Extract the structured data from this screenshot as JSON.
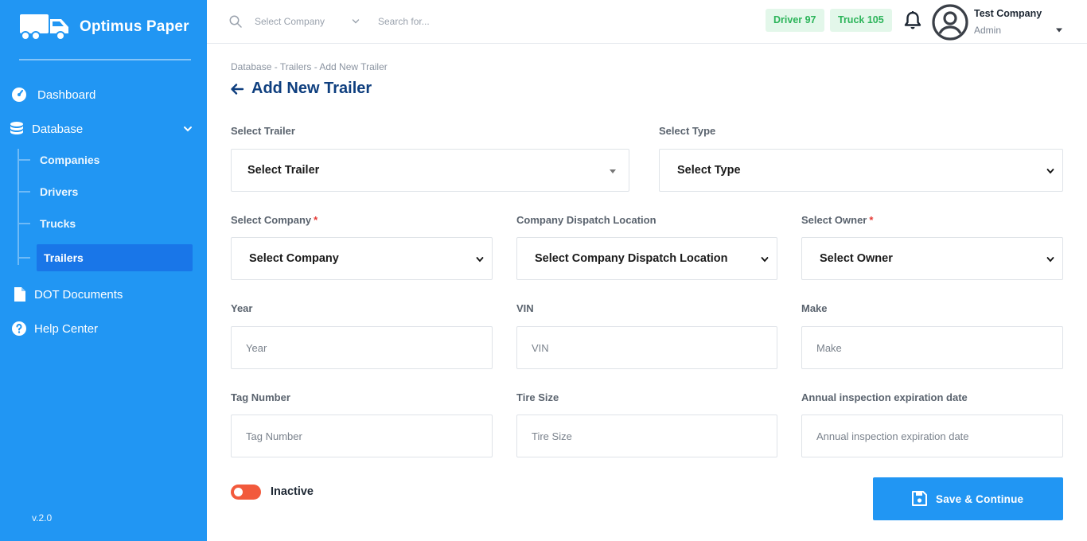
{
  "brand": {
    "name": "Optimus Paper",
    "version": "v.2.0"
  },
  "sidebar": {
    "items": [
      {
        "label": "Dashboard",
        "icon": "gauge-icon"
      },
      {
        "label": "Database",
        "icon": "database-icon"
      },
      {
        "label": "DOT Documents",
        "icon": "document-icon"
      },
      {
        "label": "Help Center",
        "icon": "help-icon"
      }
    ],
    "database_children": [
      {
        "label": "Companies"
      },
      {
        "label": "Drivers"
      },
      {
        "label": "Trucks"
      },
      {
        "label": "Trailers",
        "active": true
      }
    ]
  },
  "header": {
    "company_select": "Select Company",
    "search_placeholder": "Search for...",
    "badges": [
      {
        "label": "Driver 97"
      },
      {
        "label": "Truck 105"
      }
    ],
    "user": {
      "name": "Test Company",
      "role": "Admin"
    }
  },
  "page": {
    "breadcrumb": "Database - Trailers - Add New Trailer",
    "title": "Add New Trailer"
  },
  "form": {
    "trailer": {
      "label": "Select Trailer",
      "value": "Select Trailer"
    },
    "type": {
      "label": "Select Type",
      "value": "Select Type"
    },
    "company": {
      "label": "Select Company",
      "required": "*",
      "value": "Select Company"
    },
    "dispatch": {
      "label": "Company Dispatch Location",
      "value": "Select Company Dispatch Location"
    },
    "owner": {
      "label": "Select Owner",
      "required": "*",
      "value": "Select Owner"
    },
    "year": {
      "label": "Year",
      "placeholder": "Year"
    },
    "vin": {
      "label": "VIN",
      "placeholder": "VIN"
    },
    "make": {
      "label": "Make",
      "placeholder": "Make"
    },
    "tag": {
      "label": "Tag Number",
      "placeholder": "Tag Number"
    },
    "tire": {
      "label": "Tire Size",
      "placeholder": "Tire Size"
    },
    "inspection": {
      "label": "Annual inspection expiration date",
      "placeholder": "Annual inspection expiration date"
    },
    "status_label": "Inactive",
    "save_label": "Save & Continue"
  },
  "colors": {
    "sidebar": "#2196f3",
    "title": "#0f3f7f",
    "badge_bg": "#e3f7ea",
    "badge_text": "#2cb45a",
    "toggle_off": "#f25a3c",
    "required": "#e53935"
  }
}
